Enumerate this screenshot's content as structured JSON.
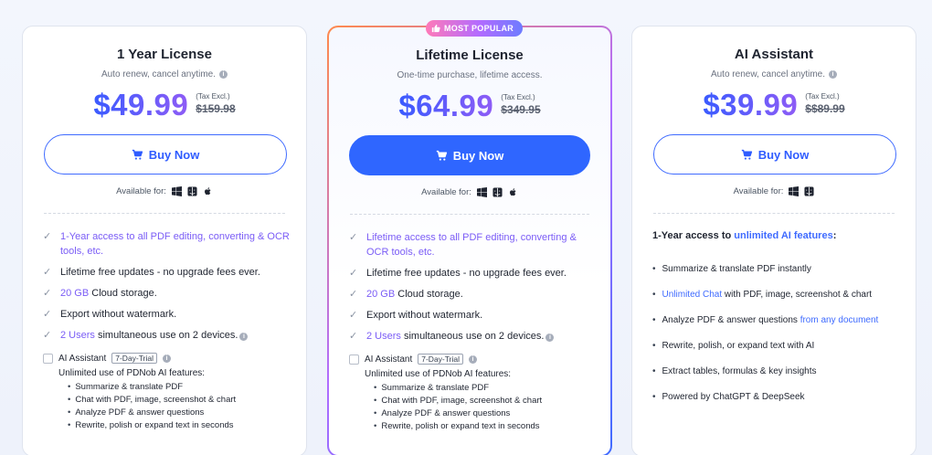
{
  "cards": [
    {
      "title": "1 Year License",
      "subtitle": "Auto renew, cancel anytime.",
      "price": "$49.99",
      "tax": "(Tax Excl.)",
      "old_price": "$159.98",
      "button": "Buy Now",
      "available_label": "Available for:",
      "features": [
        {
          "hl": "1-Year access to all PDF editing, converting & OCR tools, etc.",
          "rest": ""
        },
        {
          "pre": "Lifetime free updates - no upgrade fees ever."
        },
        {
          "hl": "20 GB",
          "rest": " Cloud storage."
        },
        {
          "pre": "Export without watermark."
        },
        {
          "hl": "2 Users",
          "rest": " simultaneous use on 2 devices."
        }
      ],
      "addon": {
        "label": "AI Assistant",
        "badge": "7-Day-Trial",
        "desc": "Unlimited use of PDNob AI features:",
        "items": [
          "Summarize & translate PDF",
          "Chat with PDF, image, screenshot & chart",
          "Analyze PDF & answer questions",
          "Rewrite, polish or expand text in seconds"
        ]
      }
    },
    {
      "badge": "MOST POPULAR",
      "title": "Lifetime License",
      "subtitle": "One-time purchase, lifetime access.",
      "price": "$64.99",
      "tax": "(Tax Excl.)",
      "old_price": "$349.95",
      "button": "Buy Now",
      "available_label": "Available for:",
      "features": [
        {
          "hl": "Lifetime access to all PDF editing, converting & OCR tools, etc.",
          "rest": ""
        },
        {
          "pre": "Lifetime free updates - no upgrade fees ever."
        },
        {
          "hl": "20 GB",
          "rest": " Cloud storage."
        },
        {
          "pre": "Export without watermark."
        },
        {
          "hl": "2 Users",
          "rest": " simultaneous use on 2 devices."
        }
      ],
      "addon": {
        "label": "AI Assistant",
        "badge": "7-Day-Trial",
        "desc": "Unlimited use of PDNob AI features:",
        "items": [
          "Summarize & translate PDF",
          "Chat with PDF, image, screenshot & chart",
          "Analyze PDF & answer questions",
          "Rewrite, polish or expand text in seconds"
        ]
      }
    },
    {
      "title": "AI Assistant",
      "subtitle": "Auto renew, cancel anytime.",
      "price": "$39.99",
      "tax": "(Tax Excl.)",
      "old_price": "$$89.99",
      "button": "Buy Now",
      "available_label": "Available for:",
      "lead_pre": "1-Year access to ",
      "lead_hl": "unlimited AI features",
      "lead_post": ":",
      "ai_items": [
        {
          "pre": "Summarize & translate PDF instantly"
        },
        {
          "hl": "Unlimited Chat",
          "rest": " with PDF, image, screenshot & chart"
        },
        {
          "pre": "Analyze PDF & answer questions ",
          "hl2": "from any document"
        },
        {
          "pre": "Rewrite, polish, or expand text with AI"
        },
        {
          "pre": "Extract tables, formulas & key insights"
        },
        {
          "pre": "Powered by ChatGPT & DeepSeek"
        }
      ]
    }
  ],
  "colors": {
    "accent": "#2f66ff",
    "highlight": "#7a5cf6",
    "border": "#dfe4ee"
  },
  "icons": [
    "cart-icon",
    "windows-icon",
    "mac-finder-icon",
    "apple-icon",
    "info-icon",
    "check-icon",
    "thumbs-up-icon"
  ]
}
